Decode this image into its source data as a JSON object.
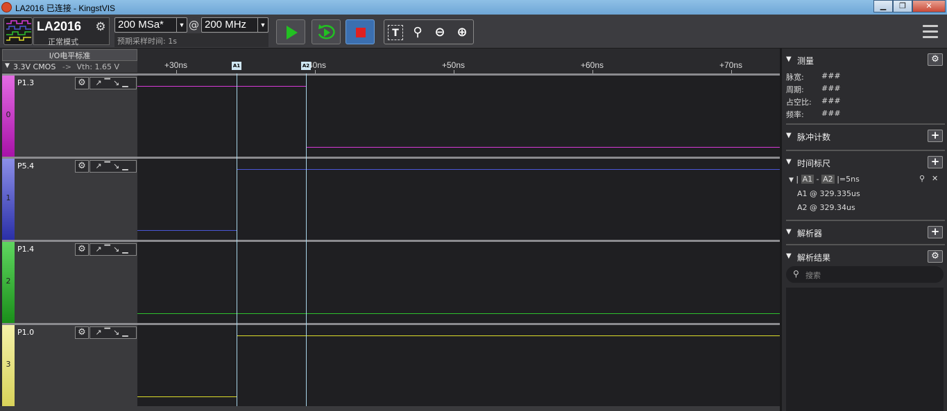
{
  "window": {
    "title": "LA2016 已连接 - KingstVIS",
    "buttons": [
      "▁",
      "❐",
      "✕"
    ]
  },
  "device": {
    "name": "LA2016",
    "mode": "正常模式"
  },
  "sampling": {
    "depth": "200 MSa*",
    "at": "@",
    "rate": "200 MHz",
    "expected_time": "预期采样时间: 1s"
  },
  "toolbar": {
    "zoom_icons": [
      "T",
      "⚲",
      "⊖",
      "⊕"
    ]
  },
  "io_standard": {
    "label": "I/O电平标准",
    "value": "3.3V CMOS",
    "arrow": "->",
    "vth": "Vth: 1.65 V"
  },
  "ruler": {
    "ticks": [
      "+30ns",
      "+40ns",
      "+50ns",
      "+60ns",
      "+70ns"
    ],
    "markers": [
      "A1",
      "A2"
    ]
  },
  "channels": [
    {
      "index": "0",
      "name": "P1.3",
      "color": "#c219c4",
      "wave": "#d93ad9"
    },
    {
      "index": "1",
      "name": "P5.4",
      "color": "#3a3fbf",
      "wave": "#4a56d6"
    },
    {
      "index": "2",
      "name": "P1.4",
      "color": "#2aa82a",
      "wave": "#2ec12e"
    },
    {
      "index": "3",
      "name": "P1.0",
      "color": "#e8e37a",
      "wave": "#dede2a"
    }
  ],
  "channel_controls": {
    "gear": "⚙",
    "triggers": "↗▔↘▁"
  },
  "panel": {
    "measure": {
      "title": "测量",
      "rows": [
        {
          "label": "脉宽:",
          "value": "###"
        },
        {
          "label": "周期:",
          "value": "###"
        },
        {
          "label": "占空比:",
          "value": "###"
        },
        {
          "label": "频率:",
          "value": "###"
        }
      ]
    },
    "pulse_count": {
      "title": "脉冲计数"
    },
    "time_ruler": {
      "title": "时间标尺",
      "diff_prefix": "|",
      "a1": "A1",
      "minus": "-",
      "a2": "A2",
      "diff_value": "|=5ns",
      "a1_pos": "A1 @ 329.335us",
      "a2_pos": "A2 @ 329.34us"
    },
    "analyzer": {
      "title": "解析器"
    },
    "analyzer_results": {
      "title": "解析结果",
      "search_placeholder": "搜索"
    }
  }
}
